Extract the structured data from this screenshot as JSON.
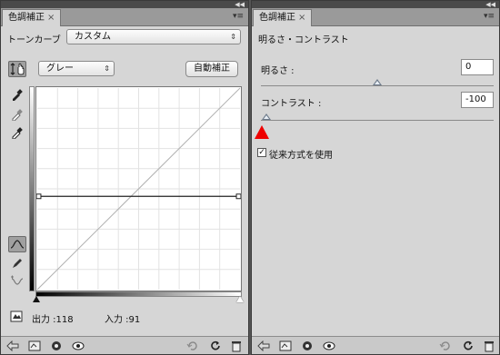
{
  "left_panel": {
    "tab_title": "色調補正",
    "preset_label": "トーンカーブ",
    "preset_value": "カスタム",
    "channel_value": "グレー",
    "auto_button": "自動補正",
    "output_label": "出力 :118",
    "input_label": "入力 :91",
    "curve": {
      "baseline_start": [
        0,
        0
      ],
      "baseline_end": [
        255,
        255
      ],
      "point_input": 91,
      "point_output": 118
    }
  },
  "right_panel": {
    "tab_title": "色調補正",
    "heading": "明るさ・コントラスト",
    "brightness_label": "明るさ :",
    "brightness_value": "0",
    "contrast_label": "コントラスト :",
    "contrast_value": "-100",
    "legacy_label": "従来方式を使用",
    "legacy_checked": true,
    "brightness_fraction": 0.5,
    "contrast_fraction": 0.0
  },
  "colors": {
    "panel_bg": "#d6d6d6",
    "marker": "#ee0000"
  }
}
